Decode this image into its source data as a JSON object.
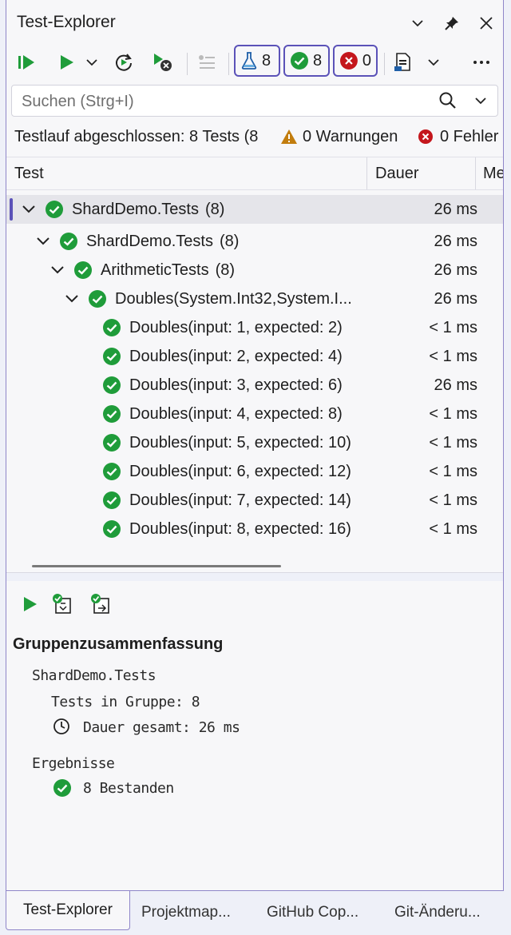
{
  "window": {
    "title": "Test-Explorer"
  },
  "toolbar": {
    "count_total": "8",
    "count_passed": "8",
    "count_failed": "0"
  },
  "search": {
    "placeholder": "Suchen (Strg+I)"
  },
  "status": {
    "summary": "Testlauf abgeschlossen: 8 Tests (8",
    "warnings": "0 Warnungen",
    "errors": "0 Fehler"
  },
  "columns": {
    "test": "Test",
    "duration": "Dauer",
    "more": "Me"
  },
  "tree": [
    {
      "name": "ShardDemo.Tests",
      "count": "(8)",
      "duration": "26 ms"
    },
    {
      "name": "ShardDemo.Tests",
      "count": "(8)",
      "duration": "26 ms"
    },
    {
      "name": "ArithmeticTests",
      "count": "(8)",
      "duration": "26 ms"
    },
    {
      "name": "Doubles(System.Int32,System.I...",
      "count": "",
      "duration": "26 ms"
    },
    {
      "name": "Doubles(input: 1, expected: 2)",
      "count": "",
      "duration": "< 1 ms"
    },
    {
      "name": "Doubles(input: 2, expected: 4)",
      "count": "",
      "duration": "< 1 ms"
    },
    {
      "name": "Doubles(input: 3, expected: 6)",
      "count": "",
      "duration": "26 ms"
    },
    {
      "name": "Doubles(input: 4, expected: 8)",
      "count": "",
      "duration": "< 1 ms"
    },
    {
      "name": "Doubles(input: 5, expected: 10)",
      "count": "",
      "duration": "< 1 ms"
    },
    {
      "name": "Doubles(input: 6, expected: 12)",
      "count": "",
      "duration": "< 1 ms"
    },
    {
      "name": "Doubles(input: 7, expected: 14)",
      "count": "",
      "duration": "< 1 ms"
    },
    {
      "name": "Doubles(input: 8, expected: 16)",
      "count": "",
      "duration": "< 1 ms"
    }
  ],
  "details": {
    "heading": "Gruppenzusammenfassung",
    "group_name": "ShardDemo.Tests",
    "tests_in_group": "Tests in Gruppe: 8",
    "total_duration": "Dauer gesamt: 26 ms",
    "results_label": "Ergebnisse",
    "passed": "8 Bestanden"
  },
  "tabs": [
    {
      "label": "Test-Explorer"
    },
    {
      "label": "Projektmap..."
    },
    {
      "label": "GitHub Cop..."
    },
    {
      "label": "Git-Änderu..."
    }
  ],
  "colors": {
    "accent": "#5b52b8",
    "success": "#1f9c3a",
    "error": "#c4161c",
    "warning": "#c27d0e"
  }
}
